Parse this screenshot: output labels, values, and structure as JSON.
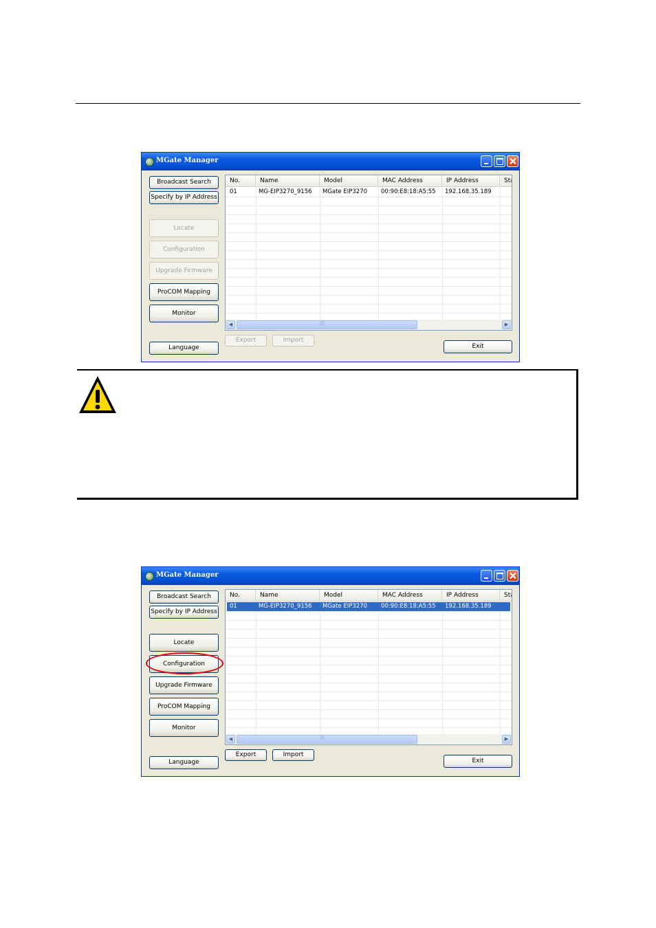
{
  "window_title": "MGate Manager",
  "buttons": {
    "broadcast_search": "Broadcast Search",
    "specify_ip": "Specify by IP Address",
    "locate": "Locate",
    "configuration": "Configuration",
    "upgrade_firmware": "Upgrade Firmware",
    "procom_mapping": "ProCOM Mapping",
    "monitor": "Monitor",
    "language": "Language",
    "export": "Export",
    "import": "Import",
    "exit": "Exit"
  },
  "columns": [
    "No.",
    "Name",
    "Model",
    "MAC Address",
    "IP Address",
    "Sta"
  ],
  "device_row": {
    "no": "01",
    "name": "MG-EIP3270_9156",
    "model": "MGate EIP3270",
    "mac": "00:90:E8:18:A5:55",
    "ip": "192.168.35.189"
  },
  "screenshot1": {
    "action_buttons_enabled": false,
    "row_selected": false
  },
  "screenshot2": {
    "action_buttons_enabled": true,
    "row_selected": true,
    "highlighted_button": "Configuration"
  },
  "icons": {
    "attention": "warning-triangle-icon"
  },
  "colors": {
    "title_bar": "#0454d8",
    "selection": "#316ac5",
    "highlight_circle": "#e0000e",
    "warning_yellow": "#ffd800"
  }
}
